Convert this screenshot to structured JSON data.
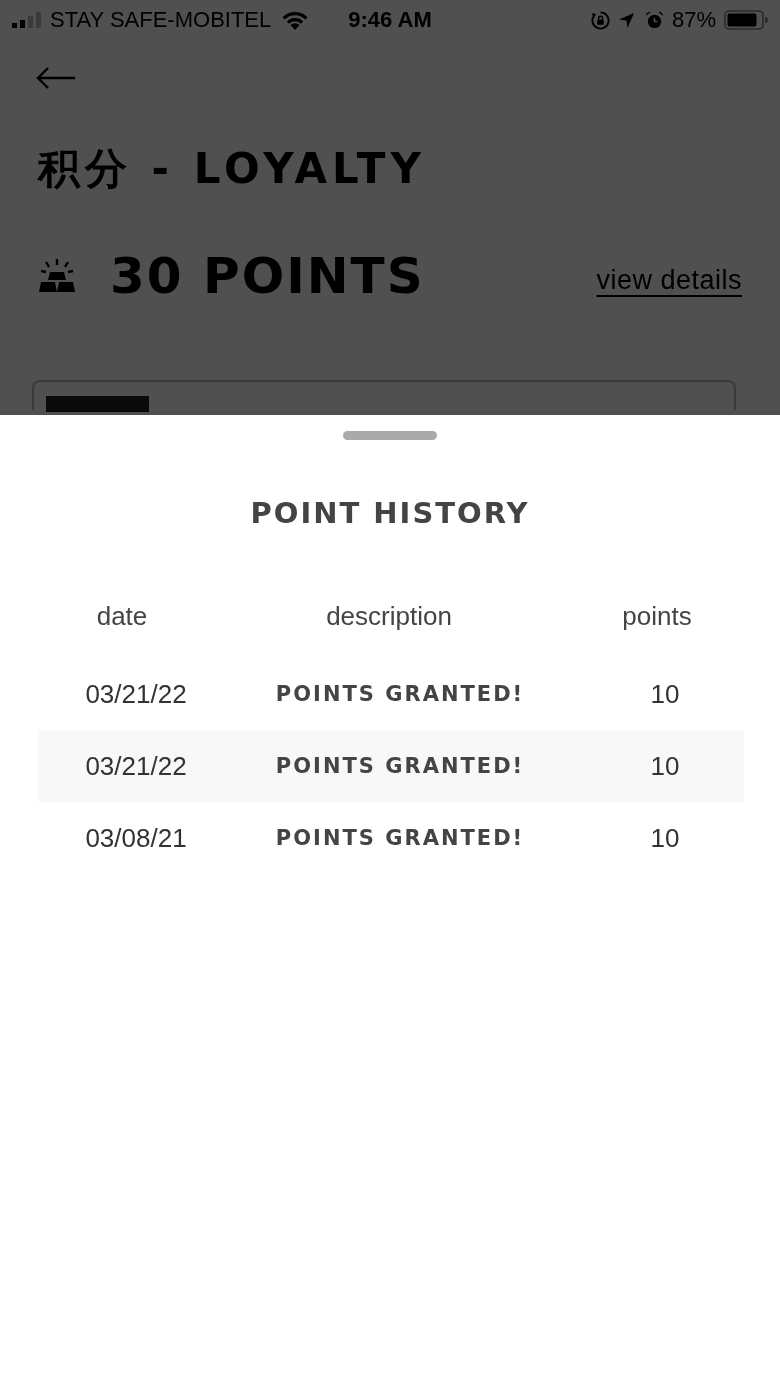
{
  "status_bar": {
    "carrier": "STAY SAFE-MOBITEL",
    "time": "9:46 AM",
    "battery": "87%"
  },
  "header": {
    "title": "积分 - LOYALTY",
    "points": "30 POINTS",
    "link": "view details"
  },
  "sheet": {
    "title": "POINT HISTORY",
    "columns": [
      "date",
      "description",
      "points"
    ],
    "rows": [
      {
        "date": "03/21/22",
        "description": "POINTS GRANTED!",
        "points": "10"
      },
      {
        "date": "03/21/22",
        "description": "POINTS GRANTED!",
        "points": "10"
      },
      {
        "date": "03/08/21",
        "description": "POINTS GRANTED!",
        "points": "10"
      }
    ]
  }
}
